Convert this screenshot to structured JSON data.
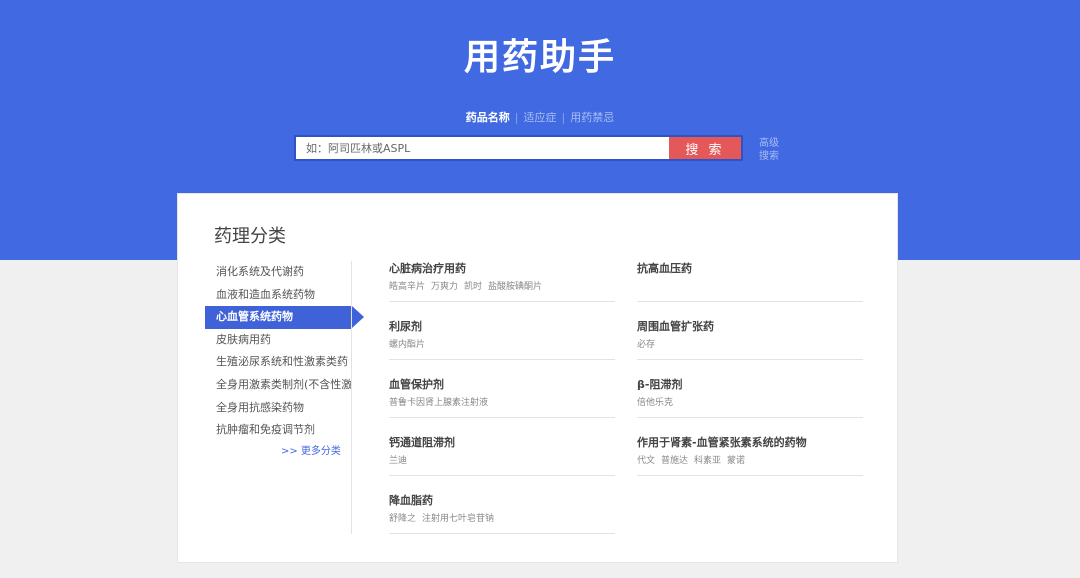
{
  "header": {
    "title": "用药助手",
    "tabs": [
      {
        "label": "药品名称",
        "active": true
      },
      {
        "label": "适应症",
        "active": false
      },
      {
        "label": "用药禁忌",
        "active": false
      }
    ],
    "tab_separator": "|",
    "search": {
      "placeholder": "如：阿司匹林或ASPL",
      "value": "",
      "button_label": "搜 索",
      "advanced_label": "高级搜索"
    }
  },
  "classification": {
    "title": "药理分类",
    "nav": [
      {
        "label": "消化系统及代谢药",
        "active": false
      },
      {
        "label": "血液和造血系统药物",
        "active": false
      },
      {
        "label": "心血管系统药物",
        "active": true
      },
      {
        "label": "皮肤病用药",
        "active": false
      },
      {
        "label": "生殖泌尿系统和性激素类药",
        "active": false
      },
      {
        "label": "全身用激素类制剂(不含性激",
        "active": false
      },
      {
        "label": "全身用抗感染药物",
        "active": false
      },
      {
        "label": "抗肿瘤和免疫调节剂",
        "active": false
      }
    ],
    "more_label": ">> 更多分类",
    "categories": [
      {
        "title": "心脏病治疗用药",
        "drugs": [
          "皓高辛片",
          "万爽力",
          "凯时",
          "盐酸胺碘酮片"
        ]
      },
      {
        "title": "抗高血压药",
        "drugs": []
      },
      {
        "title": "利尿剂",
        "drugs": [
          "螺内酯片"
        ]
      },
      {
        "title": "周围血管扩张药",
        "drugs": [
          "必存"
        ]
      },
      {
        "title": "血管保护剂",
        "drugs": [
          "普鲁卡因肾上腺素注射液"
        ]
      },
      {
        "title": "β-阻滞剂",
        "drugs": [
          "倍他乐克"
        ]
      },
      {
        "title": "钙通道阻滞剂",
        "drugs": [
          "兰迪"
        ]
      },
      {
        "title": "作用于肾素-血管紧张素系统的药物",
        "drugs": [
          "代文",
          "普施达",
          "科素亚",
          "蒙诺"
        ]
      },
      {
        "title": "降血脂药",
        "drugs": [
          "舒降之",
          "注射用七叶皂苷钠"
        ]
      }
    ]
  },
  "colors": {
    "brand_blue": "#4169e1",
    "search_button": "#e4585a",
    "active_nav": "#3f62d8"
  }
}
